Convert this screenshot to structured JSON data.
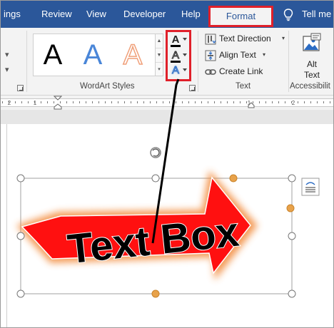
{
  "tabs": {
    "ings": "ings",
    "review": "Review",
    "view": "View",
    "developer": "Developer",
    "help": "Help",
    "format": "Format",
    "tell_me": "Tell me"
  },
  "ribbon": {
    "wordart_group": {
      "label": "WordArt Styles",
      "samples": [
        "A",
        "A",
        "A"
      ]
    },
    "text_effects": {
      "fill_glyph": "A",
      "outline_glyph": "A",
      "effects_glyph": "A"
    },
    "text_group": {
      "label": "Text",
      "text_direction": "Text Direction",
      "align_text": "Align Text",
      "create_link": "Create Link"
    },
    "accessibility_group": {
      "label": "Accessibilit",
      "alt_text_line1": "Alt",
      "alt_text_line2": "Text"
    }
  },
  "ruler": {
    "numbers": [
      "2",
      "1",
      "1",
      "2"
    ]
  },
  "document": {
    "wordart_text": "Text Box"
  },
  "colors": {
    "tab_bar": "#2b579a",
    "highlight": "#e0202a",
    "arrow_fill": "#ff1010",
    "selection_handle_accent": "#f0a030"
  }
}
